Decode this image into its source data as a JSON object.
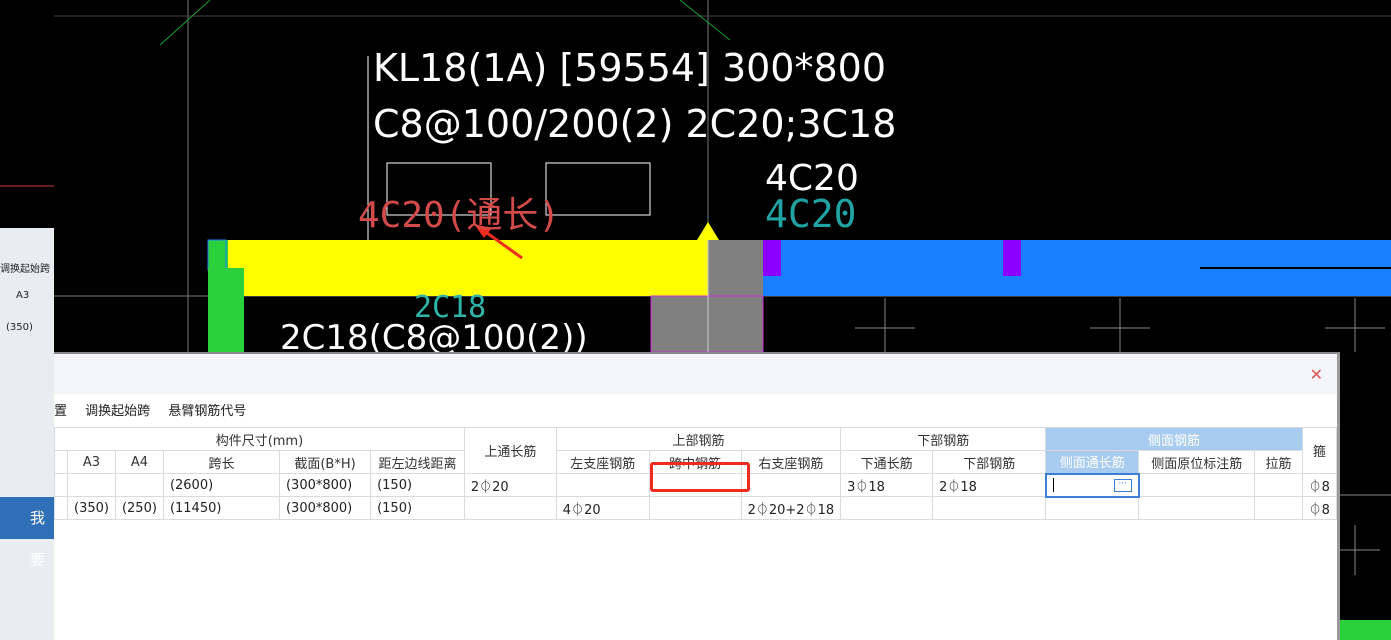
{
  "cad": {
    "beam_label_line1": "KL18(1A) [59554] 300*800",
    "beam_label_line2": "C8@100/200(2) 2C20;3C18",
    "top_rebar_note": "4C20",
    "top_rebar_note_cyan": "4C20",
    "red_note": "4C20(通长)",
    "bottom_rebar_cyan": "2C18",
    "bottom_rebar_note": "2C18(C8@100(2))"
  },
  "background_window": {
    "toolbar_fragment": "调换起始跨",
    "col_fragment": "A3",
    "value_fragment": "(350)",
    "button_label": "我要"
  },
  "dialog": {
    "close_label": "✕",
    "toolbar": [
      "置",
      "调换起始跨",
      "悬臂钢筋代号"
    ],
    "group_headers": {
      "size": "构件尺寸(mm)",
      "top_through": "上通长筋",
      "top_rebar": "上部钢筋",
      "bottom_rebar": "下部钢筋",
      "side_rebar": "侧面钢筋",
      "stirrup_fragment": "箍"
    },
    "columns": [
      "A3",
      "A4",
      "跨长",
      "截面(B*H)",
      "距左边线距离",
      "左支座钢筋",
      "跨中钢筋",
      "右支座钢筋",
      "下通长筋",
      "下部钢筋",
      "侧面通长筋",
      "侧面原位标注筋",
      "拉筋"
    ],
    "rows": [
      {
        "a3": "",
        "a4": "",
        "span": "(2600)",
        "section": "(300*800)",
        "dist": "(150)",
        "top_through": "2⏀20",
        "left": "",
        "mid": "",
        "right": "",
        "bottom_through": "3⏀18",
        "bottom": "2⏀18",
        "side_through": "",
        "side_note": "",
        "tie": "",
        "stirrup": "⏀8"
      },
      {
        "a3": "(350)",
        "a4": "(250)",
        "span": "(11450)",
        "section": "(300*800)",
        "dist": "(150)",
        "top_through": "",
        "left": "4⏀20",
        "mid": "",
        "right": "2⏀20+2⏀18",
        "bottom_through": "",
        "bottom": "",
        "side_through": "",
        "side_note": "",
        "tie": "",
        "stirrup": "⏀8"
      }
    ],
    "ellipsis": "···"
  },
  "colors": {
    "beam_yellow": "#ffff00",
    "beam_blue": "#1a7fff",
    "support_gray": "#808080",
    "annotation_red": "#f02b20",
    "header_highlight": "#a8ccf0"
  }
}
